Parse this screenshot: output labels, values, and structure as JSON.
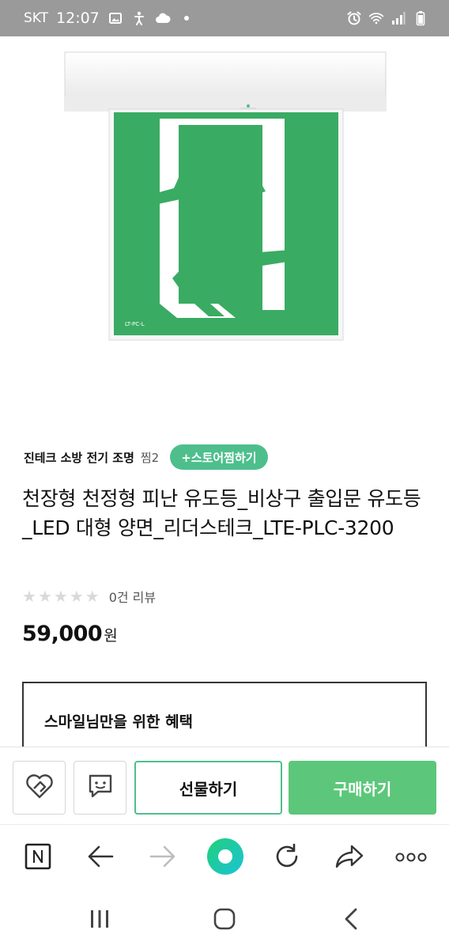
{
  "status_bar": {
    "carrier": "SKT",
    "time": "12:07",
    "left_icons": [
      "image-icon",
      "accessibility-icon",
      "cloud-icon",
      "dot-icon"
    ],
    "right_icons": [
      "alarm-icon",
      "wifi-icon",
      "signal-icon",
      "battery-icon"
    ]
  },
  "product_image": {
    "sign_label": "LT-PC-L",
    "colors": {
      "sign_green": "#3aab63",
      "housing": "#f2f2f2"
    }
  },
  "store": {
    "name": "진테크 소방 전기 조명",
    "wish_count": "찜2",
    "follow_label": "+스토어찜하기"
  },
  "product": {
    "title": "천장형 천정형 피난 유도등_비상구 출입문 유도등_LED 대형 양면_리더스테크_LTE-PLC-3200",
    "rating": 0,
    "max_rating": 5,
    "review_count": "0건 리뷰",
    "price": "59,000",
    "price_unit": "원"
  },
  "benefit": {
    "title": "스마일님만을 위한 혜택"
  },
  "purchase_bar": {
    "gift_label": "선물하기",
    "buy_label": "구매하기",
    "colors": {
      "accent": "#4ebf8c",
      "buy_bg": "#5cc77a"
    }
  },
  "browser_toolbar": {
    "items": [
      "naver-home-icon",
      "back-icon",
      "forward-icon",
      "green-dot-icon",
      "reload-icon",
      "share-icon",
      "more-icon"
    ]
  },
  "nav_bar": {
    "items": [
      "recent-apps-icon",
      "home-icon",
      "back-nav-icon"
    ]
  }
}
